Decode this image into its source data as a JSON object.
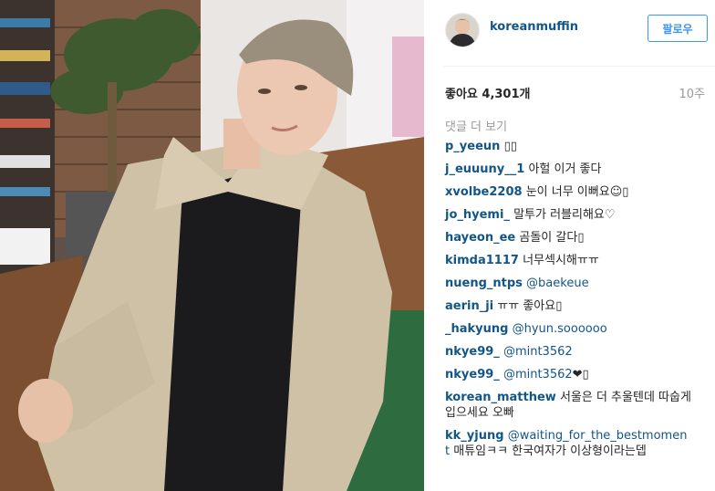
{
  "post": {
    "username": "koreanmuffin",
    "follow_label": "팔로우",
    "likes": "좋아요 4,301개",
    "time_ago": "10주",
    "view_more_comments": "댓글 더 보기"
  },
  "comments": [
    {
      "user": "p_yeeun",
      "text": "",
      "mention": "",
      "trail": "▯▯"
    },
    {
      "user": "j_euuuny__1",
      "text": "아헐 이거 좋다",
      "mention": "",
      "trail": ""
    },
    {
      "user": "xvolbe2208",
      "text": "눈이 너무 이뻐요☺▯",
      "mention": "",
      "trail": ""
    },
    {
      "user": "jo_hyemi_",
      "text": "말투가 러블리해요♡",
      "mention": "",
      "trail": ""
    },
    {
      "user": "hayeon_ee",
      "text": "곰돌이 갈다▯",
      "mention": "",
      "trail": ""
    },
    {
      "user": "kimda1117",
      "text": "너무섹시해ㅠㅠ",
      "mention": "",
      "trail": ""
    },
    {
      "user": "nueng_ntps",
      "text": "",
      "mention": "@baekeue",
      "trail": ""
    },
    {
      "user": "aerin_ji",
      "text": "ㅠㅠ 좋아요▯",
      "mention": "",
      "trail": ""
    },
    {
      "user": "_hakyung",
      "text": "",
      "mention": "@hyun.soooooo",
      "trail": ""
    },
    {
      "user": "nkye99_",
      "text": "",
      "mention": "@mint3562",
      "trail": ""
    },
    {
      "user": "nkye99_",
      "text": "",
      "mention": "@mint3562",
      "trail": "❤▯"
    },
    {
      "user": "korean_matthew",
      "text": "서울은 더 추울텐데 따숩게 입으세요 오빠",
      "mention": "",
      "trail": ""
    },
    {
      "user": "kk_yjung",
      "text": "",
      "mention": "@waiting_for_the_bestmoment",
      "trail": " 매튜임ㅋㅋ 한국여자가 이상형이라는뎁"
    }
  ],
  "icons": {
    "avatar": "profile-avatar",
    "photo": "post-photo"
  }
}
